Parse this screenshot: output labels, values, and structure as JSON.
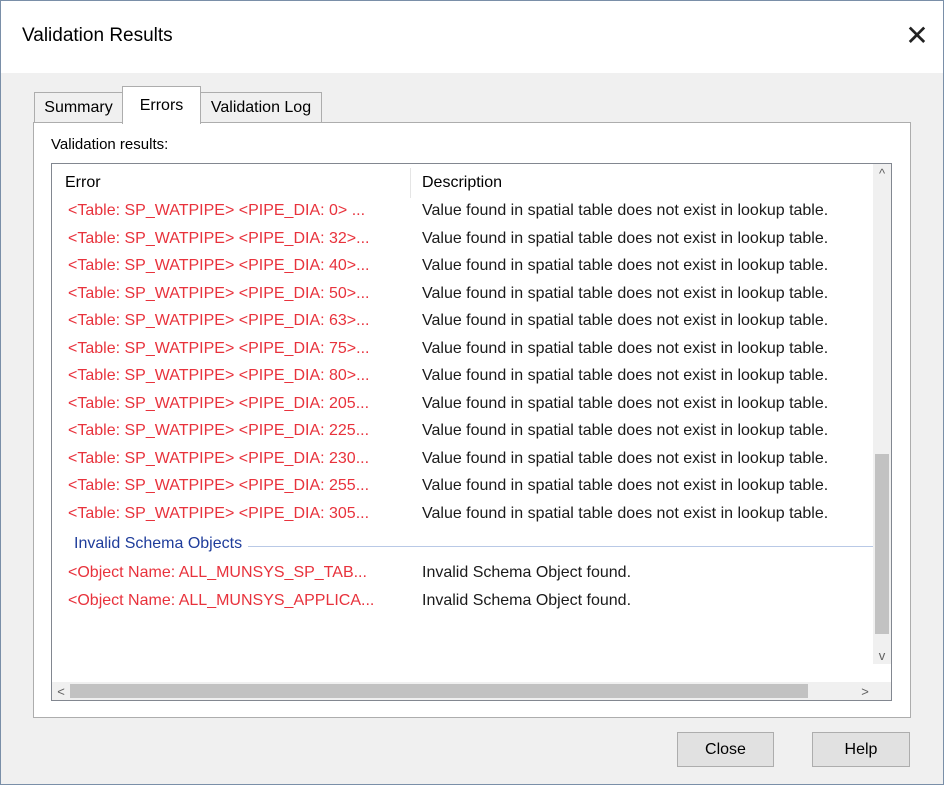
{
  "window": {
    "title": "Validation Results",
    "close_glyph": "✕"
  },
  "tabs": [
    {
      "label": "Summary",
      "active": false
    },
    {
      "label": "Errors",
      "active": true
    },
    {
      "label": "Validation Log",
      "active": false
    }
  ],
  "panel": {
    "label": "Validation results:"
  },
  "list": {
    "columns": {
      "error": "Error",
      "description": "Description"
    },
    "rows": [
      {
        "error": "<Table: SP_WATPIPE> <PIPE_DIA: 0> ...",
        "description": "Value found in spatial table does not exist in lookup table."
      },
      {
        "error": "<Table: SP_WATPIPE> <PIPE_DIA: 32>...",
        "description": "Value found in spatial table does not exist in lookup table."
      },
      {
        "error": "<Table: SP_WATPIPE> <PIPE_DIA: 40>...",
        "description": "Value found in spatial table does not exist in lookup table."
      },
      {
        "error": "<Table: SP_WATPIPE> <PIPE_DIA: 50>...",
        "description": "Value found in spatial table does not exist in lookup table."
      },
      {
        "error": "<Table: SP_WATPIPE> <PIPE_DIA: 63>...",
        "description": "Value found in spatial table does not exist in lookup table."
      },
      {
        "error": "<Table: SP_WATPIPE> <PIPE_DIA: 75>...",
        "description": "Value found in spatial table does not exist in lookup table."
      },
      {
        "error": "<Table: SP_WATPIPE> <PIPE_DIA: 80>...",
        "description": "Value found in spatial table does not exist in lookup table."
      },
      {
        "error": "<Table: SP_WATPIPE> <PIPE_DIA: 205...",
        "description": "Value found in spatial table does not exist in lookup table."
      },
      {
        "error": "<Table: SP_WATPIPE> <PIPE_DIA: 225...",
        "description": "Value found in spatial table does not exist in lookup table."
      },
      {
        "error": "<Table: SP_WATPIPE> <PIPE_DIA: 230...",
        "description": "Value found in spatial table does not exist in lookup table."
      },
      {
        "error": "<Table: SP_WATPIPE> <PIPE_DIA: 255...",
        "description": "Value found in spatial table does not exist in lookup table."
      },
      {
        "error": "<Table: SP_WATPIPE> <PIPE_DIA: 305...",
        "description": "Value found in spatial table does not exist in lookup table."
      }
    ],
    "group": {
      "title": "Invalid Schema Objects",
      "rows": [
        {
          "error": "<Object Name: ALL_MUNSYS_SP_TAB...",
          "description": "Invalid Schema Object found."
        },
        {
          "error": "<Object Name: ALL_MUNSYS_APPLICA...",
          "description": "Invalid Schema Object found."
        }
      ]
    },
    "scroll": {
      "up": "^",
      "down": "v",
      "left": "<",
      "right": ">"
    }
  },
  "buttons": {
    "close": "Close",
    "help": "Help"
  },
  "colors": {
    "error_text": "#e8323c",
    "group_title": "#1f3d9b"
  }
}
